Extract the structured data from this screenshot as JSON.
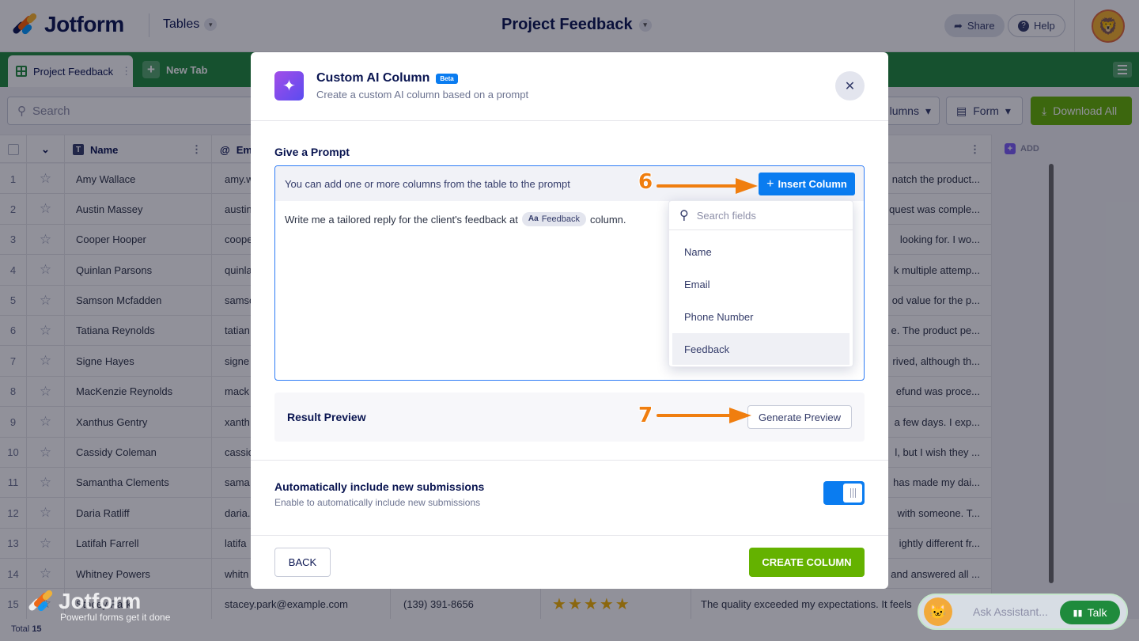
{
  "header": {
    "brand": "Jotform",
    "section_menu": "Tables",
    "project_title": "Project Feedback",
    "share_label": "Share",
    "help_label": "Help"
  },
  "tabs": {
    "active_tab": "Project Feedback",
    "new_tab_label": "New Tab"
  },
  "toolbar": {
    "search_placeholder": "Search",
    "columns_label": "lumns",
    "form_label": "Form",
    "download_label": "Download All"
  },
  "table": {
    "columns": [
      "Name",
      "Em"
    ],
    "add_column_label": "ADD",
    "rows": [
      {
        "idx": "1",
        "name": "Amy Wallace",
        "email": "amy.w",
        "feedback": "natch the product..."
      },
      {
        "idx": "2",
        "name": "Austin Massey",
        "email": "austin",
        "feedback": "quest was comple..."
      },
      {
        "idx": "3",
        "name": "Cooper Hooper",
        "email": "coope",
        "feedback": "looking for. I wo..."
      },
      {
        "idx": "4",
        "name": "Quinlan Parsons",
        "email": "quinla",
        "feedback": "k multiple attemp..."
      },
      {
        "idx": "5",
        "name": "Samson Mcfadden",
        "email": "samso",
        "feedback": "od value for the p..."
      },
      {
        "idx": "6",
        "name": "Tatiana Reynolds",
        "email": "tatian",
        "feedback": "e. The product pe..."
      },
      {
        "idx": "7",
        "name": "Signe Hayes",
        "email": "signe",
        "feedback": "rived, although th..."
      },
      {
        "idx": "8",
        "name": "MacKenzie Reynolds",
        "email": "mack",
        "feedback": "efund was proce..."
      },
      {
        "idx": "9",
        "name": "Xanthus Gentry",
        "email": "xanth",
        "feedback": "a few days. I exp..."
      },
      {
        "idx": "10",
        "name": "Cassidy Coleman",
        "email": "cassic",
        "feedback": "l, but I wish they ..."
      },
      {
        "idx": "11",
        "name": "Samantha Clements",
        "email": "sama",
        "feedback": "has made my dai..."
      },
      {
        "idx": "12",
        "name": "Daria Ratliff",
        "email": "daria.",
        "feedback": "with someone. T..."
      },
      {
        "idx": "13",
        "name": "Latifah Farrell",
        "email": "latifa",
        "feedback": "ightly different fr..."
      },
      {
        "idx": "14",
        "name": "Whitney Powers",
        "email": "whitn",
        "feedback": "and answered all ..."
      },
      {
        "idx": "15",
        "name": "Stacey Park",
        "email": "stacey.park@example.com",
        "phone": "(139) 391-8656",
        "rating": 5,
        "feedback": "The quality exceeded my expectations. It feels"
      }
    ],
    "total_label": "Total",
    "total_count": "15"
  },
  "watermark": {
    "brand": "Jotform",
    "tagline": "Powerful forms get it done"
  },
  "assistant": {
    "placeholder": "Ask Assistant...",
    "talk_label": "Talk"
  },
  "modal": {
    "title": "Custom AI Column",
    "badge": "Beta",
    "subtitle": "Create a custom AI column based on a prompt",
    "prompt_label": "Give a Prompt",
    "prompt_hint": "You can add one or more columns from the table to the prompt",
    "insert_label": "Insert Column",
    "prompt_text_before": "Write me a tailored reply for the client's feedback at",
    "prompt_chip_prefix": "Aa",
    "prompt_chip": "Feedback",
    "prompt_text_after": "column.",
    "fields_search_placeholder": "Search fields",
    "fields": [
      "Name",
      "Email",
      "Phone Number",
      "Feedback"
    ],
    "preview_label": "Result Preview",
    "generate_label": "Generate Preview",
    "auto_title": "Automatically include new submissions",
    "auto_sub": "Enable to automatically include new submissions",
    "auto_enabled": true,
    "back_label": "BACK",
    "create_label": "CREATE COLUMN"
  },
  "annotations": {
    "step_insert": "6",
    "step_generate": "7"
  },
  "colors": {
    "brand_green": "#1f8b3c",
    "action_green": "#64b200",
    "primary_blue": "#0a7cf0",
    "annotation_orange": "#f07e0f"
  }
}
